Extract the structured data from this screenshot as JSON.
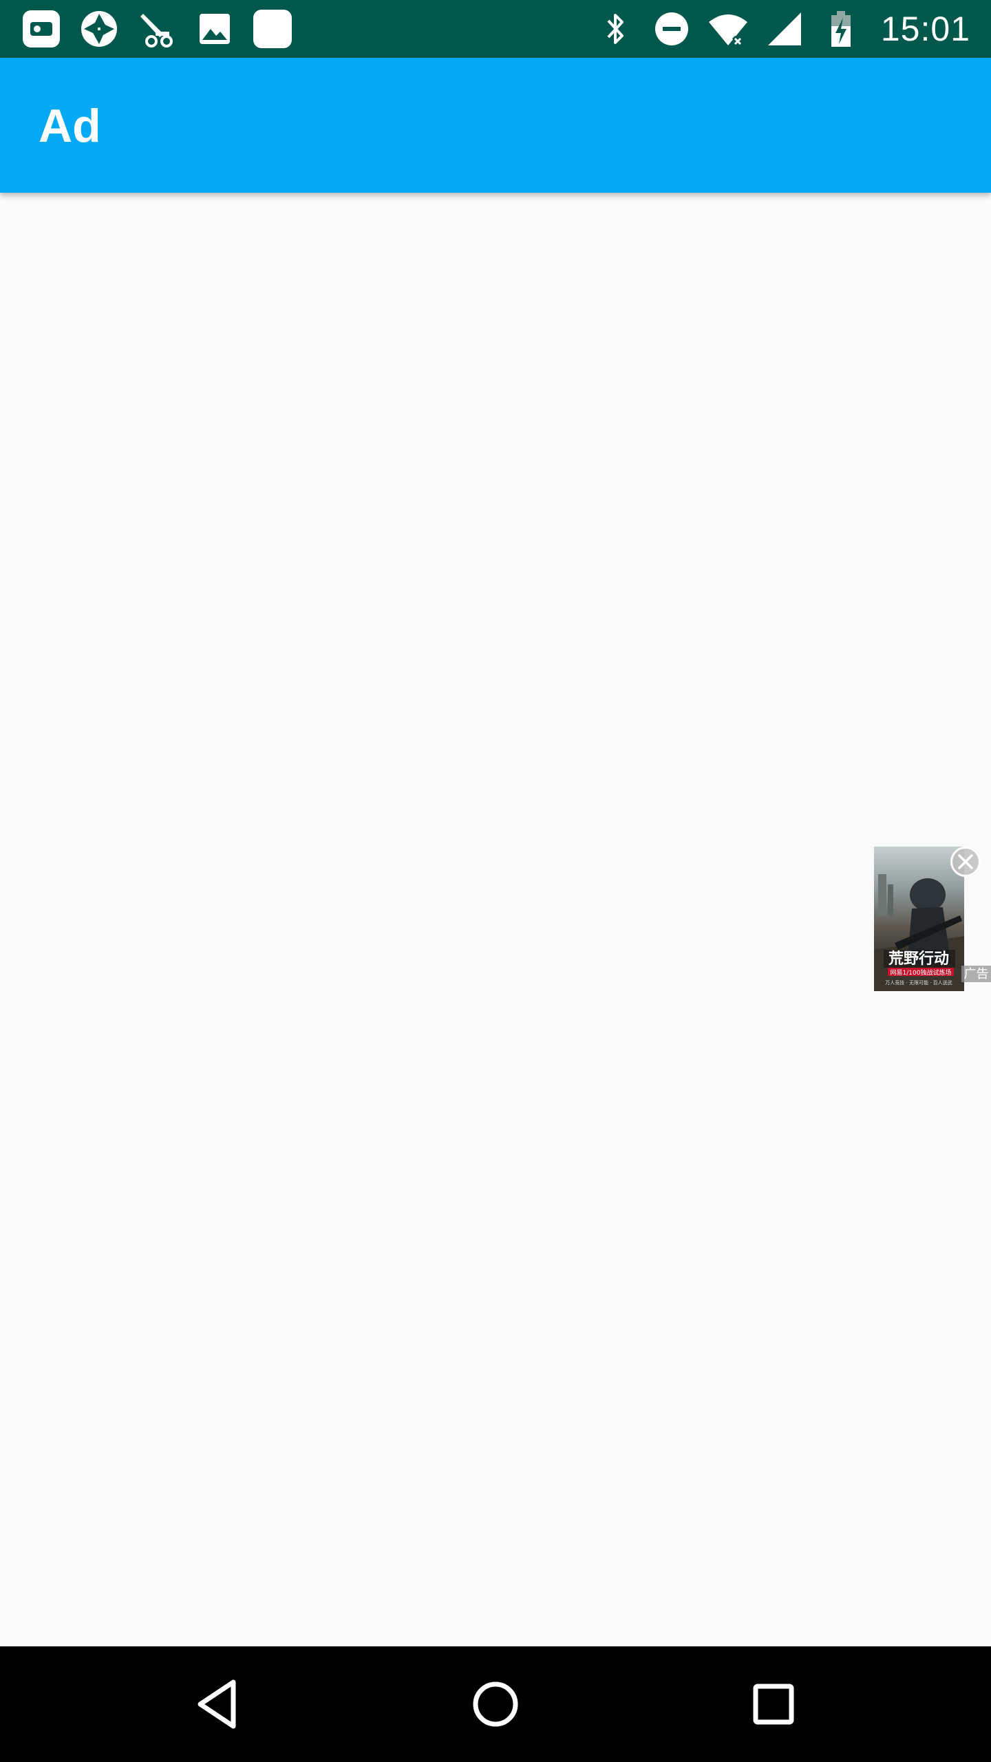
{
  "status_bar": {
    "time": "15:01",
    "left_icons": [
      "wallet-icon",
      "aperture-icon",
      "scooter-icon",
      "image-icon",
      "blank-app-icon"
    ],
    "right_icons": [
      "bluetooth-icon",
      "do-not-disturb-icon",
      "wifi-icon",
      "signal-icon",
      "battery-charging-icon"
    ],
    "background_color": "#00574b"
  },
  "app_bar": {
    "title": "Ad",
    "background_color": "#03a9f4"
  },
  "ad": {
    "headline": "荒野行动",
    "subline": "网易1/100独战试炼场",
    "tagline": "万人竞技 · 无限可能 · 百人送武",
    "badge": "广告",
    "close_icon": "close-icon"
  },
  "nav_bar": {
    "buttons": [
      "back-icon",
      "home-icon",
      "recents-icon"
    ]
  }
}
